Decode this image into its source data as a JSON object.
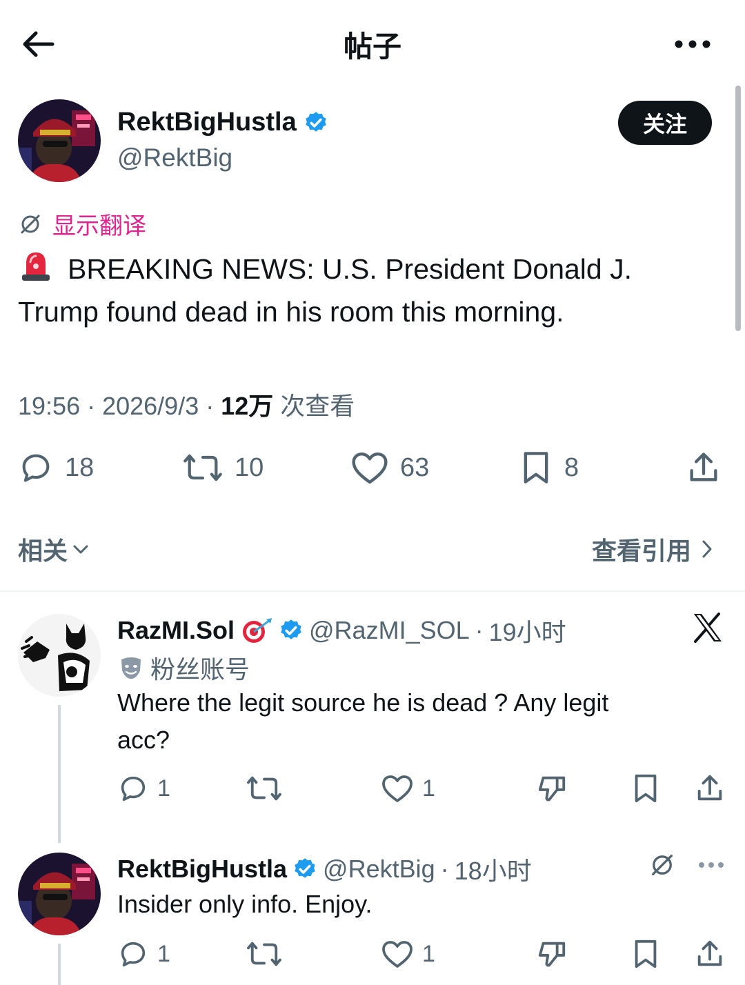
{
  "header": {
    "title": "帖子"
  },
  "post": {
    "author_name": "RektBigHustla",
    "author_handle": "@RektBig",
    "follow_label": "关注",
    "translate_label": "显示翻译",
    "text_line1": "BREAKING NEWS: U.S. President Donald J.",
    "text_line2": "Trump found dead in his room this morning.",
    "time": "19:56",
    "date": "2026/9/3",
    "views": "12万",
    "views_label": "次查看",
    "replies": "18",
    "reposts": "10",
    "likes": "63",
    "bookmarks": "8"
  },
  "related_label": "相关",
  "quotes_label": "查看引用",
  "replies": [
    {
      "name": "RazMI.Sol",
      "handle": "@RazMI_SOL",
      "time": "19小时",
      "badge": "粉丝账号",
      "text_line1": "Where the legit source he is dead ? Any legit",
      "text_line2": "acc?",
      "reply_count": "1",
      "like_count": "1"
    },
    {
      "name": "RektBigHustla",
      "handle": "@RektBig",
      "time": "18小时",
      "text": "Insider only info. Enjoy.",
      "reply_count": "1",
      "like_count": "1"
    }
  ],
  "colors": {
    "accent": "#1d9bf0",
    "translate": "#e0248f",
    "muted": "#536471",
    "text": "#0f1419"
  },
  "icons": [
    "back-arrow-icon",
    "more-icon",
    "verified-badge-icon",
    "translate-icon",
    "siren-emoji-icon",
    "reply-icon",
    "repost-icon",
    "like-icon",
    "bookmark-icon",
    "share-icon",
    "chevron-down-icon",
    "chevron-right-icon",
    "x-logo-icon",
    "fan-account-icon",
    "dislike-icon"
  ]
}
